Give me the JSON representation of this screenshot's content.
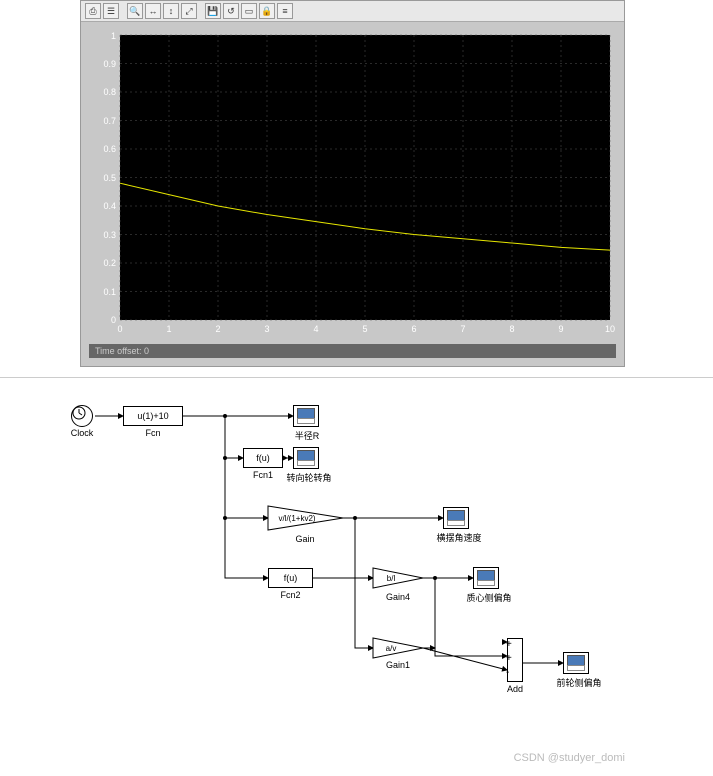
{
  "scope": {
    "time_offset_label": "Time offset:  0"
  },
  "chart_data": {
    "type": "line",
    "title": "",
    "xlabel": "",
    "ylabel": "",
    "xlim": [
      0,
      10
    ],
    "ylim": [
      0,
      1
    ],
    "xticks": [
      0,
      1,
      2,
      3,
      4,
      5,
      6,
      7,
      8,
      9,
      10
    ],
    "yticks": [
      0,
      0.1,
      0.2,
      0.3,
      0.4,
      0.5,
      0.6,
      0.7,
      0.8,
      0.9,
      1
    ],
    "grid": true,
    "series": [
      {
        "name": "signal",
        "color": "#e6e600",
        "x": [
          0,
          1,
          2,
          3,
          4,
          5,
          6,
          7,
          8,
          9,
          10
        ],
        "y": [
          0.48,
          0.44,
          0.4,
          0.37,
          0.345,
          0.32,
          0.3,
          0.285,
          0.27,
          0.255,
          0.245
        ]
      }
    ]
  },
  "blocks": {
    "clock_label": "Clock",
    "fcn_expr": "u(1)+10",
    "fcn_label": "Fcn",
    "fcn1_expr": "f(u)",
    "fcn1_label": "Fcn1",
    "fcn2_expr": "f(u)",
    "fcn2_label": "Fcn2",
    "gain_expr": "v/l/(1+kv2)",
    "gain_label": "Gain",
    "gain4_expr": "b/l",
    "gain4_label": "Gain4",
    "gain1_expr": "a/v",
    "gain1_label": "Gain1",
    "add_label": "Add",
    "scopeR_label": "半径R",
    "scopeSteer_label": "转向轮转角",
    "scopeYaw_label": "横摆角速度",
    "scopeCg_label": "质心侧偏角",
    "scopeFront_label": "前轮侧偏角"
  },
  "watermark": "CSDN @studyer_domi"
}
